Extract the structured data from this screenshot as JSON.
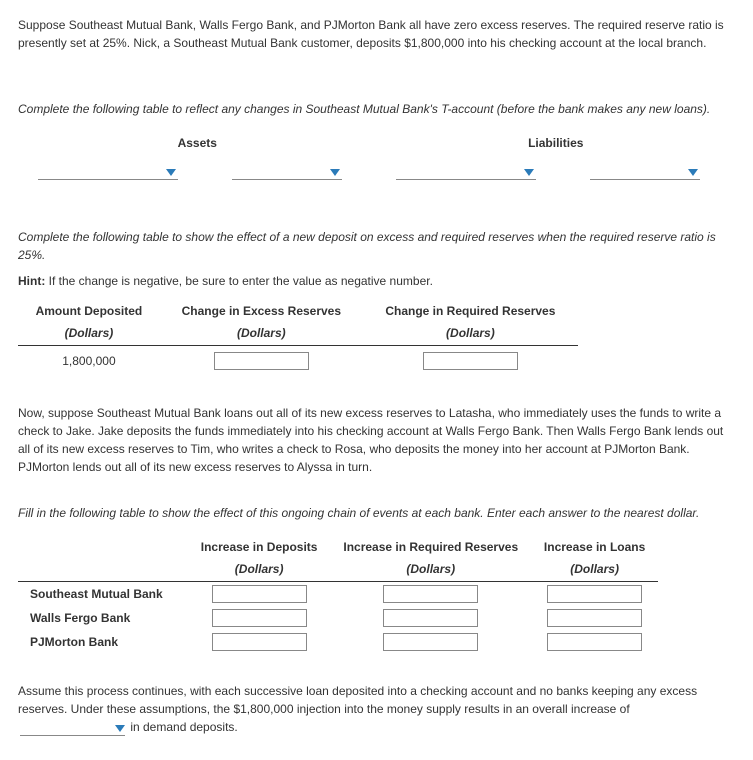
{
  "intro_p1": "Suppose Southeast Mutual Bank, Walls Fergo Bank, and PJMorton Bank all have zero excess reserves. The required reserve ratio is presently set at 25%. Nick, a Southeast Mutual Bank customer, deposits $1,800,000 into his checking account at the local branch.",
  "q1_prompt": "Complete the following table to reflect any changes in Southeast Mutual Bank's T-account (before the bank makes any new loans).",
  "t_account": {
    "assets_label": "Assets",
    "liabilities_label": "Liabilities"
  },
  "q2_prompt": "Complete the following table to show the effect of a new deposit on excess and required reserves when the required reserve ratio is 25%.",
  "hint_label": "Hint:",
  "hint_text": " If the change is negative, be sure to enter the value as negative number.",
  "reserve_table": {
    "col1": "Amount Deposited",
    "col2": "Change in Excess Reserves",
    "col3": "Change in Required Reserves",
    "unit": "(Dollars)",
    "amount": "1,800,000"
  },
  "narrative": "Now, suppose Southeast Mutual Bank loans out all of its new excess reserves to Latasha, who immediately uses the funds to write a check to Jake. Jake deposits the funds immediately into his checking account at Walls Fergo Bank. Then Walls Fergo Bank lends out all of its new excess reserves to Tim, who writes a check to Rosa, who deposits the money into her account at PJMorton Bank. PJMorton lends out all of its new excess reserves to Alyssa in turn.",
  "q3_prompt": "Fill in the following table to show the effect of this ongoing chain of events at each bank. Enter each answer to the nearest dollar.",
  "bank_table": {
    "col_deposits": "Increase in Deposits",
    "col_required": "Increase in Required Reserves",
    "col_loans": "Increase in Loans",
    "unit": "(Dollars)",
    "banks": [
      "Southeast Mutual Bank",
      "Walls Fergo Bank",
      "PJMorton Bank"
    ]
  },
  "closing_pre": "Assume this process continues, with each successive loan deposited into a checking account and no banks keeping any excess reserves. Under these assumptions, the $1,800,000 injection into the money supply results in an overall increase of ",
  "closing_post": " in demand deposits."
}
